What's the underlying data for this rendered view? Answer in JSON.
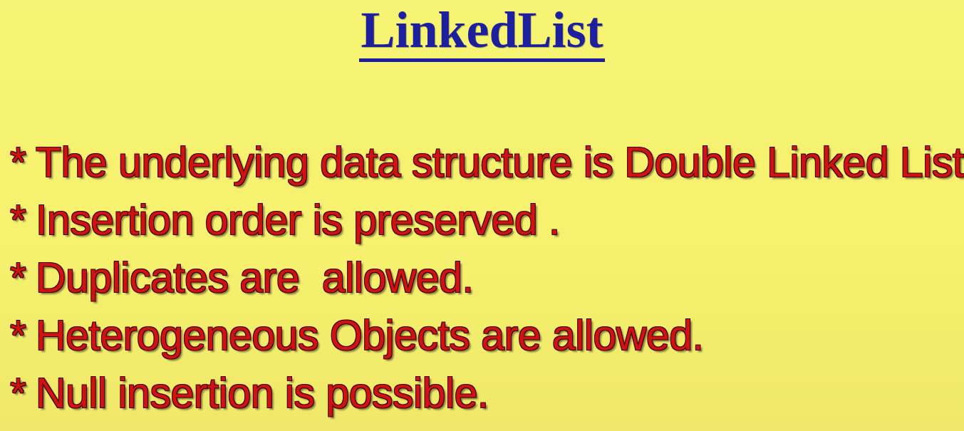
{
  "slide": {
    "title": "LinkedList",
    "bullet_marker": "*",
    "bullets": [
      "The underlying data structure is Double Linked List.",
      "Insertion order is preserved .",
      "Duplicates are  allowed.",
      "Heterogeneous Objects are allowed.",
      "Null insertion is possible."
    ]
  },
  "colors": {
    "background": "#f7f475",
    "title": "#1d1f9c",
    "bullet_text": "#d01212"
  }
}
